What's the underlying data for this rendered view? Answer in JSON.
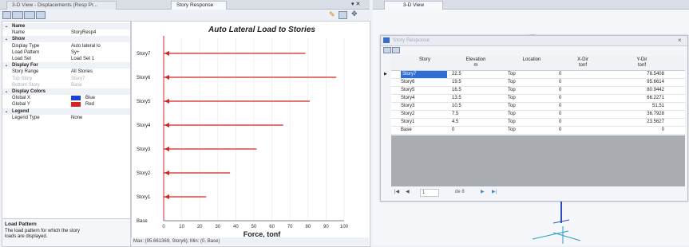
{
  "left_tabs": [
    "3-D View",
    "Displacements (Resp Pr...",
    "Story Response"
  ],
  "right_tabs": [
    "3-D View"
  ],
  "tab_close": "▾ ✕",
  "property_grid": {
    "rows": [
      {
        "type": "cat",
        "name": "Name"
      },
      {
        "type": "prop",
        "name": "Name",
        "value": "StoryResp4"
      },
      {
        "type": "cat",
        "name": "Show"
      },
      {
        "type": "prop",
        "name": "Display Type",
        "value": "Auto lateral lo"
      },
      {
        "type": "prop",
        "name": "Load Pattern",
        "value": "Sy+"
      },
      {
        "type": "prop",
        "name": "Load Set",
        "value": "Load Set 1"
      },
      {
        "type": "cat",
        "name": "Display For"
      },
      {
        "type": "prop",
        "name": "Story Range",
        "value": "All Stories"
      },
      {
        "type": "dim",
        "name": "Top Story",
        "value": "Story7"
      },
      {
        "type": "dim",
        "name": "Bottom Story",
        "value": "Base"
      },
      {
        "type": "cat",
        "name": "Display Colors"
      },
      {
        "type": "color",
        "name": "Global X",
        "value": "Blue",
        "color": "#1f3fd0"
      },
      {
        "type": "color",
        "name": "Global Y",
        "value": "Red",
        "color": "#d42323"
      },
      {
        "type": "cat",
        "name": "Legend"
      },
      {
        "type": "prop",
        "name": "Legend Type",
        "value": "None"
      }
    ],
    "help_title": "Load Pattern",
    "help_text": "The load pattern for which the story loads are displayed."
  },
  "chart_data": {
    "type": "bar",
    "title": "Auto Lateral Load to Stories",
    "xlabel": "Force, tonf",
    "ylabel": "",
    "categories": [
      "Base",
      "Story1",
      "Story2",
      "Story3",
      "Story4",
      "Story5",
      "Story6",
      "Story7"
    ],
    "values": [
      0,
      23.5627,
      36.7928,
      51.51,
      66.2271,
      80.9442,
      95.6614,
      78.5408
    ],
    "xlim": [
      0,
      100
    ],
    "xticks": [
      "0",
      "10",
      "20",
      "30",
      "40",
      "50",
      "60",
      "70",
      "80",
      "90",
      "100"
    ],
    "bar_color": "#d42323",
    "grid": true
  },
  "chart_status": "Max: (95.661369, Story6);  Min: (0, Base)",
  "dialog": {
    "title": "Story Response",
    "columns": [
      {
        "label": "Story",
        "unit": ""
      },
      {
        "label": "Elevation",
        "unit": "m"
      },
      {
        "label": "Location",
        "unit": ""
      },
      {
        "label": "X-Dir",
        "unit": "tonf"
      },
      {
        "label": "Y-Dir",
        "unit": "tonf"
      }
    ],
    "rows": [
      [
        "Story7",
        "22.5",
        "Top",
        "0",
        "78.5408"
      ],
      [
        "Story6",
        "19.5",
        "Top",
        "0",
        "95.6614"
      ],
      [
        "Story5",
        "16.5",
        "Top",
        "0",
        "80.9442"
      ],
      [
        "Story4",
        "13.5",
        "Top",
        "0",
        "66.2271"
      ],
      [
        "Story3",
        "10.5",
        "Top",
        "0",
        "51.51"
      ],
      [
        "Story2",
        "7.5",
        "Top",
        "0",
        "36.7928"
      ],
      [
        "Story1",
        "4.5",
        "Top",
        "0",
        "23.5627"
      ],
      [
        "Base",
        "0",
        "Top",
        "0",
        "0"
      ]
    ],
    "pager": {
      "first": "|◀",
      "prev": "◀",
      "page": "1",
      "of": "de 8",
      "next": "▶",
      "last": "▶|"
    }
  }
}
